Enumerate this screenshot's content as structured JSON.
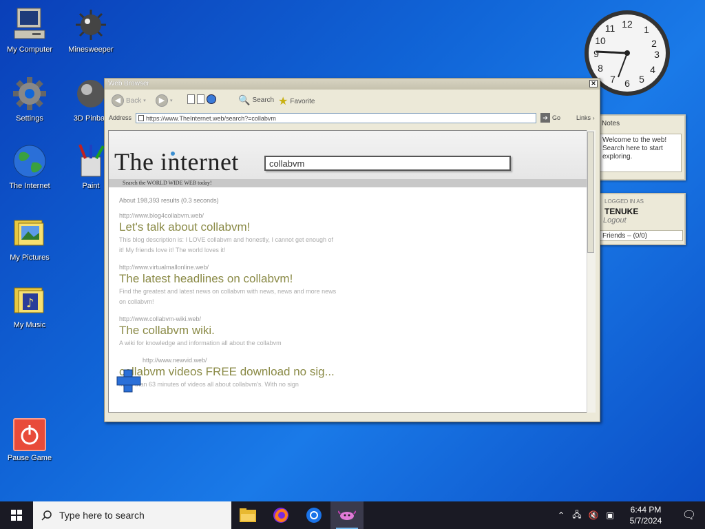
{
  "desktop": {
    "icons": [
      {
        "label": "My Computer"
      },
      {
        "label": "Minesweeper"
      },
      {
        "label": "Settings"
      },
      {
        "label": "3D Pinball"
      },
      {
        "label": "The Internet"
      },
      {
        "label": "Paint"
      },
      {
        "label": "My Pictures"
      },
      {
        "label": "My Music"
      },
      {
        "label": "Pause Game"
      }
    ]
  },
  "gadgets": {
    "notes": {
      "title": "Notes",
      "text": "Welcome to the web! Search here to start exploring."
    },
    "user": {
      "tag": "LOGGED IN AS",
      "username": "TENUKE",
      "logout": "Logout",
      "friends": "Friends – (0/0)"
    }
  },
  "browser": {
    "title": "Web Browser",
    "toolbar": {
      "back": "Back",
      "search": "Search",
      "favorite": "Favorite"
    },
    "address_label": "Address",
    "address": "https://www.TheInternet.web/search?=collabvm",
    "go": "Go",
    "links": "Links",
    "site": {
      "logo": "The internet",
      "query": "collabvm",
      "tagline": "Search the WORLD WIDE WEB today!",
      "result_count": "About 198,393 results (0.3 seconds)",
      "results": [
        {
          "url": "http://www.blog4collabvm.web/",
          "title": "Let's talk about collabvm!",
          "desc": "This blog description is: I LOVE collabvm and honestly, I cannot get enough of it! My friends love it! The world loves it!"
        },
        {
          "url": "http://www.virtualmallonline.web/",
          "title": "The latest headlines on collabvm!",
          "desc": "Find the greatest and latest news on collabvm with news, news and more news on collabvm!"
        },
        {
          "url": "http://www.collabvm-wiki.web/",
          "title": "The collabvm wiki.",
          "desc": "A wiki for knowledge and information all about the collabvm"
        },
        {
          "url": "http://www.newvid.web/",
          "title": "collabvm videos FREE download no sig...",
          "desc": "More than 63 minutes of videos all about collabvm's. With no sign"
        }
      ]
    }
  },
  "taskbar": {
    "search_placeholder": "Type here to search",
    "time": "6:44 PM",
    "date": "5/7/2024"
  },
  "colors": {
    "desktop_bg": "#1166d8",
    "result_title": "#8a8a46",
    "taskbar": "#1a1a24"
  }
}
